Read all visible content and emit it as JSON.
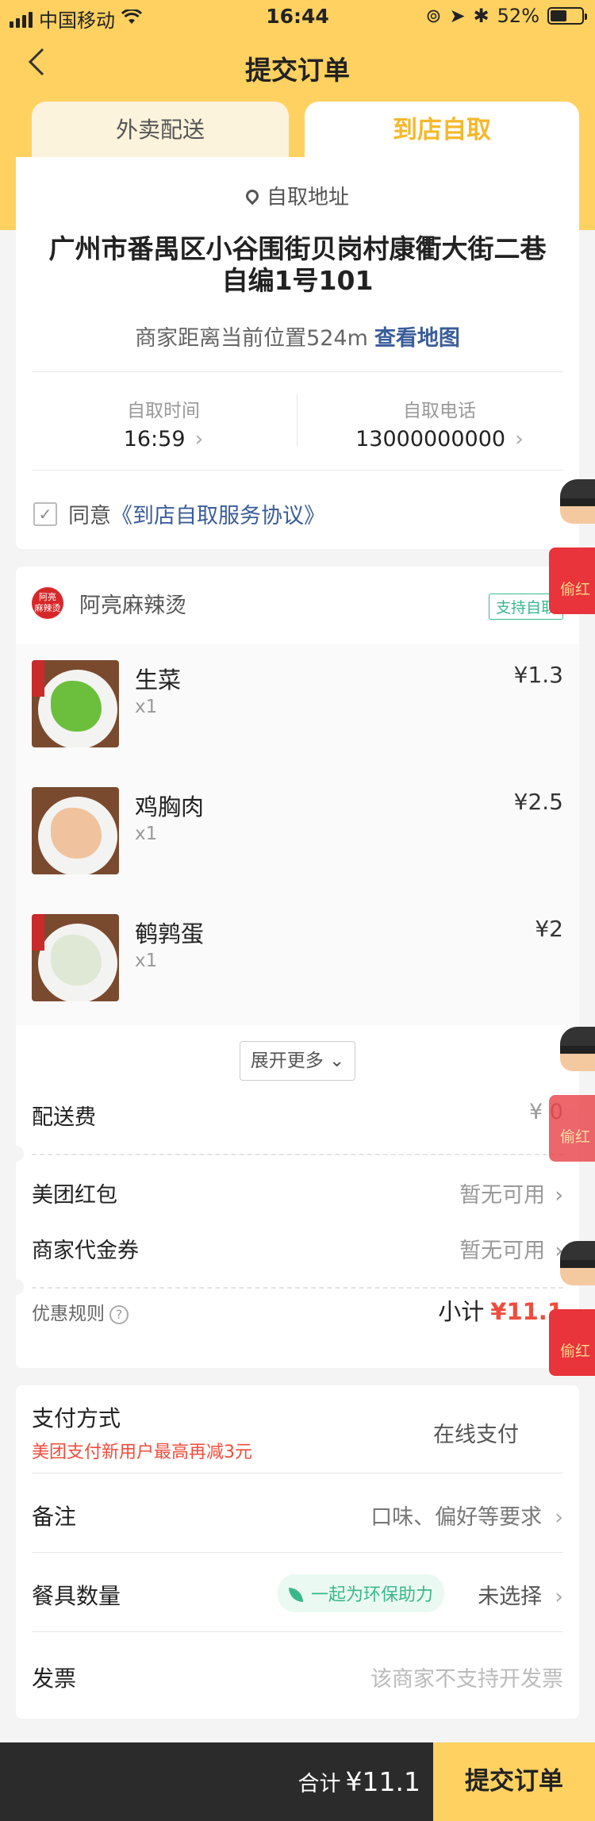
{
  "status_bar": {
    "carrier": "中国移动",
    "time": "16:44",
    "battery": "52%",
    "battery_level": 0.52
  },
  "nav": {
    "title": "提交订单"
  },
  "tabs": [
    {
      "label": "外卖配送"
    },
    {
      "label": "到店自取"
    }
  ],
  "pickup": {
    "address_label": "自取地址",
    "address": "广州市番禺区小谷围街贝岗村康衢大街二巷自编1号101",
    "distance_text": "商家距离当前位置524m",
    "map_link": "查看地图",
    "time_label": "自取时间",
    "time_value": "16:59",
    "phone_label": "自取电话",
    "phone_value": "13000000000",
    "agree_prefix": "同意",
    "agree_link": "《到店自取服务协议》"
  },
  "shop": {
    "logo_text": "阿亮麻辣烫",
    "name": "阿亮麻辣烫",
    "badge": "支持自取"
  },
  "items": [
    {
      "name": "生菜",
      "qty": "x1",
      "price": "¥1.3",
      "color": "#6cbf3d"
    },
    {
      "name": "鸡胸肉",
      "qty": "x1",
      "price": "¥2.5",
      "color": "#f0c29e"
    },
    {
      "name": "鹌鹑蛋",
      "qty": "x1",
      "price": "¥2",
      "color": "#dfe8d4"
    }
  ],
  "order": {
    "expand": "展开更多",
    "delivery_fee_label": "配送费",
    "delivery_fee_value": "¥ 0",
    "redpack_label": "美团红包",
    "redpack_value": "暂无可用",
    "voucher_label": "商家代金券",
    "voucher_value": "暂无可用",
    "rules_label": "优惠规则",
    "subtotal_label": "小计",
    "subtotal_value": "¥11.1"
  },
  "settings": {
    "payment_label": "支付方式",
    "payment_promo": "美团支付新用户最高再减3元",
    "payment_value": "在线支付",
    "remark_label": "备注",
    "remark_value": "口味、偏好等要求",
    "tableware_label": "餐具数量",
    "eco_text": "一起为环保助力",
    "tableware_value": "未选择",
    "invoice_label": "发票",
    "invoice_value": "该商家不支持开发票"
  },
  "bottom": {
    "total_label": "合计",
    "total_value": "¥11.1",
    "submit": "提交订单"
  },
  "floating": {
    "label": "偷红"
  },
  "colors": {
    "brand_yellow": "#ffd160",
    "accent_orange": "#f4b82c",
    "price_red": "#f04c3c",
    "link_blue": "#3a5d9a",
    "eco_green": "#3ab88d"
  }
}
